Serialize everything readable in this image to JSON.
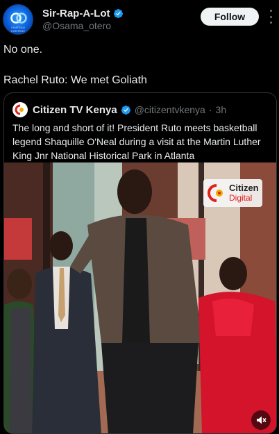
{
  "author": {
    "display_name": "Sir-Rap-A-Lot",
    "handle": "@Osama_otero",
    "avatar_text": "CHATEAU CONTENT"
  },
  "follow_label": "Follow",
  "tweet": {
    "text": "No one.\n\nRachel Ruto: We met Goliath"
  },
  "quoted": {
    "name": "Citizen TV Kenya",
    "handle": "@citizentvkenya",
    "separator": "·",
    "time": "3h",
    "text": "The long and short of it! President Ruto meets basketball legend Shaquille O'Neal during a visit at the Martin Luther King Jnr National Historical Park in Atlanta",
    "watermark": {
      "line1": "Citizen",
      "line2": "Digital"
    }
  },
  "colors": {
    "background": "#000000",
    "verified": "#1d9bf0",
    "text": "#e7e9ea",
    "secondary": "#71767b",
    "follow_bg": "#eff3f4"
  },
  "icons": {
    "verified": "verified-badge-icon",
    "more": "more-dots-icon",
    "volume": "volume-muted-icon"
  }
}
